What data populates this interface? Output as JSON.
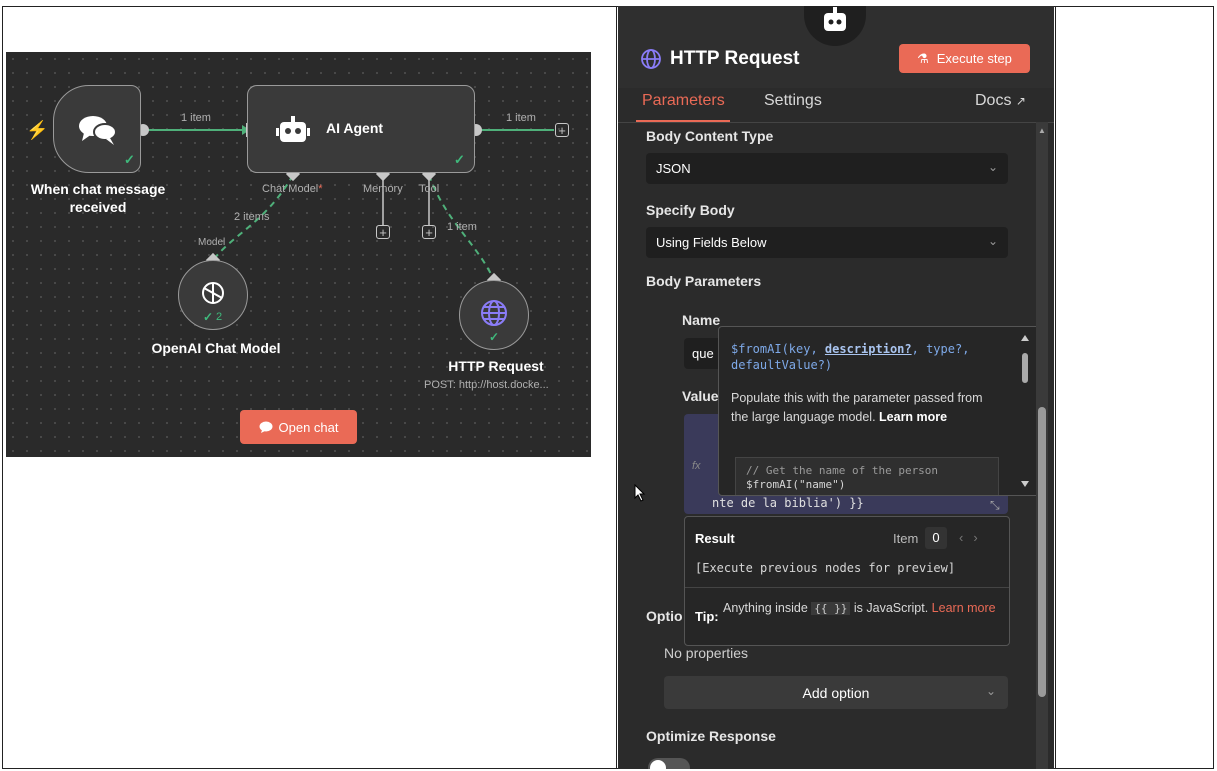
{
  "canvas": {
    "trigger_label": "When chat message received",
    "agent_label": "AI Agent",
    "edge_trigger_agent": "1 item",
    "edge_agent_out": "1 item",
    "port_chat_model": "Chat Model",
    "port_chat_model_required": "*",
    "port_memory": "Memory",
    "port_tool": "Tool",
    "edge_model_items": "2 items",
    "edge_tool_items": "1 item",
    "model_port_label": "Model",
    "openai_label": "OpenAI Chat Model",
    "openai_count": "2",
    "http_label": "HTTP Request",
    "http_sub": "POST: http://host.docke...",
    "open_chat": "Open chat"
  },
  "panel": {
    "title": "HTTP Request",
    "execute_button": "Execute step",
    "tabs": [
      "Parameters",
      "Settings"
    ],
    "docs": "Docs",
    "body_content_type_label": "Body Content Type",
    "body_content_type_value": "JSON",
    "specify_body_label": "Specify Body",
    "specify_body_value": "Using Fields Below",
    "body_parameters_label": "Body Parameters",
    "name_label": "Name",
    "name_value_partial": "que",
    "value_label": "Value",
    "value_expression_tail": "nte de la biblia') }}",
    "options_label_partial": "Optio",
    "no_properties": "No properties",
    "add_option": "Add option",
    "optimize_response": "Optimize Response"
  },
  "tooltip": {
    "sig_fn": "$fromAI(key, ",
    "sig_arg": "description?",
    "sig_rest": ", type?, defaultValue?)",
    "desc": "Populate this with the parameter passed from the large language model. ",
    "learn_more": "Learn more",
    "code_comment": "// Get the name of the person",
    "code_line": "$fromAI(\"name\")"
  },
  "result": {
    "title": "Result",
    "item_label": "Item",
    "item_value": "0",
    "preview": "[Execute previous nodes for preview]",
    "tip_label": "Tip:",
    "tip_text_a": "Anything inside ",
    "tip_code": "{{ }}",
    "tip_text_b": " is JavaScript. ",
    "tip_link": "Learn more"
  },
  "colors": {
    "accent": "#ea6a56",
    "success": "#3fb97c",
    "canvas_bg": "#2a2a2a",
    "panel_bg": "#2b2b2b"
  }
}
